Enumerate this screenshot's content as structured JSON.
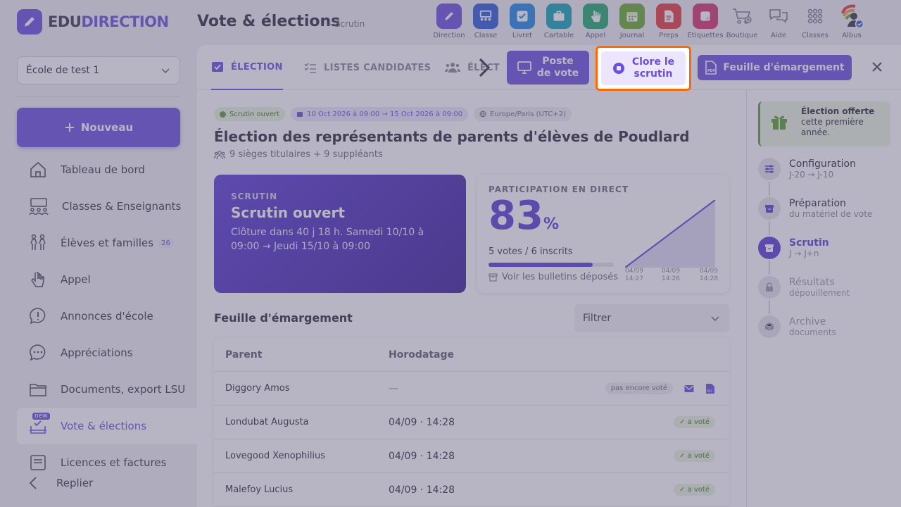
{
  "brand": {
    "name_part1": "EDU",
    "name_part2": "DIRECTION"
  },
  "header": {
    "title": "Vote & élections",
    "subtitle": "– Scrutin"
  },
  "apps": [
    {
      "label": "Direction",
      "color": "#6c4fe0",
      "icon": "pencil-icon"
    },
    {
      "label": "Classe",
      "color": "#2a5bd7",
      "icon": "classroom-icon"
    },
    {
      "label": "Livret",
      "color": "#1e88e5",
      "icon": "check-icon"
    },
    {
      "label": "Cartable",
      "color": "#12a4b5",
      "icon": "briefcase-icon"
    },
    {
      "label": "Appel",
      "color": "#20a86a",
      "icon": "hand-icon"
    },
    {
      "label": "Journal",
      "color": "#6aa92a",
      "icon": "calendar-icon"
    },
    {
      "label": "Preps",
      "color": "#e5393a",
      "icon": "document-icon"
    },
    {
      "label": "Etiquettes",
      "color": "#d6336c",
      "icon": "label-icon"
    },
    {
      "label": "Boutique",
      "color": "",
      "icon": "cart-icon"
    },
    {
      "label": "Aide",
      "color": "",
      "icon": "chat-icon"
    },
    {
      "label": "Classes",
      "color": "",
      "icon": "grid-icon"
    },
    {
      "label": "Albus",
      "color": "",
      "icon": "avatar"
    }
  ],
  "sidebar": {
    "school": "École de test 1",
    "new_button": "Nouveau",
    "items": [
      {
        "label": "Tableau de bord",
        "icon": "home-icon"
      },
      {
        "label": "Classes & Enseignants",
        "icon": "people-icon"
      },
      {
        "label": "Élèves et familles",
        "icon": "family-icon",
        "badge": "26"
      },
      {
        "label": "Appel",
        "icon": "hand-icon"
      },
      {
        "label": "Annonces d'école",
        "icon": "announcement-icon"
      },
      {
        "label": "Appréciations",
        "icon": "comment-icon"
      },
      {
        "label": "Documents, export LSU",
        "icon": "folder-icon"
      },
      {
        "label": "Vote & élections",
        "icon": "ballot-icon",
        "tag": "new"
      },
      {
        "label": "Licences et factures",
        "icon": "invoice-icon"
      }
    ],
    "collapse": "Replier"
  },
  "tabs": {
    "election": "ÉLECTION",
    "lists": "LISTES CANDIDATES",
    "voters": "ÉLECT",
    "poste_line1": "Poste",
    "poste_line2": "de vote",
    "close_line1": "Clore le",
    "close_line2": "scrutin",
    "sheet": "Feuille d'émargement"
  },
  "election": {
    "status": "Scrutin ouvert",
    "dates": "10 Oct 2026 à 09:00 → 15 Oct 2026 à 09:00",
    "timezone": "Europe/Paris (UTC+2)",
    "title": "Élection des représentants de parents d'élèves de Poudlard",
    "seats": "9 sièges titulaires + 9 suppléants"
  },
  "scrutin_card": {
    "kicker": "SCRUTIN",
    "title": "Scrutin ouvert",
    "desc": "Clôture dans 40 j 18 h. Samedi 10/10 à 09:00 → Jeudi 15/10 à 09:00"
  },
  "participation": {
    "kicker": "PARTICIPATION EN DIRECT",
    "percent": "83",
    "percent_sign": "%",
    "fill": 0.83,
    "votes": "5 votes / 6 inscrits",
    "link": "Voir les bulletins déposés",
    "ticks": [
      {
        "date": "04/09",
        "time": "14:27"
      },
      {
        "date": "04/09",
        "time": "14:26"
      },
      {
        "date": "04/09",
        "time": "14:28"
      }
    ]
  },
  "sheet": {
    "title": "Feuille d'émargement",
    "filter": "Filtrer",
    "col_parent": "Parent",
    "col_time": "Horodatage",
    "rows": [
      {
        "name": "Diggory Amos",
        "time": "—",
        "status": "pas encore voté",
        "voted": false
      },
      {
        "name": "Londubat Augusta",
        "time": "04/09 · 14:28",
        "status": "a voté",
        "voted": true
      },
      {
        "name": "Lovegood Xenophilius",
        "time": "04/09 · 14:28",
        "status": "a voté",
        "voted": true
      },
      {
        "name": "Malefoy Lucius",
        "time": "04/09 · 14:28",
        "status": "a voté",
        "voted": true
      }
    ]
  },
  "rail": {
    "gift_title": "Élection offerte",
    "gift_text": "cette première année.",
    "steps": [
      {
        "name": "Configuration",
        "sub": "J-20 → J-10",
        "state": "done",
        "icon": "sliders-icon"
      },
      {
        "name": "Préparation",
        "sub": "du matériel de vote",
        "state": "done",
        "icon": "box-icon"
      },
      {
        "name": "Scrutin",
        "sub": "J → J+n",
        "state": "active",
        "icon": "ballot-box-icon"
      },
      {
        "name": "Résultats",
        "sub": "dépouillement",
        "state": "future",
        "icon": "lock-icon"
      },
      {
        "name": "Archive",
        "sub": "documents",
        "state": "future",
        "icon": "cube-icon"
      }
    ]
  },
  "colors": {
    "accent": "#6c4fe0",
    "highlight": "#ff6a00",
    "success": "#5aa02c"
  }
}
